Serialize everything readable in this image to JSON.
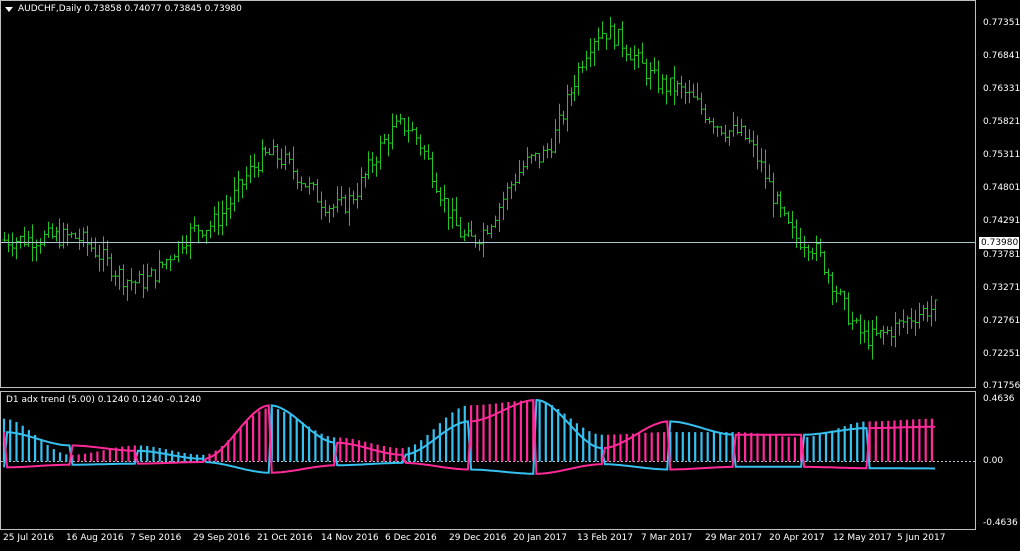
{
  "main": {
    "symbol_header": "AUDCHF,Daily",
    "ohlc": "0.73858 0.74077 0.73845 0.73980",
    "current_price": "0.73980",
    "y_ticks": [
      "0.77351",
      "0.76841",
      "0.76331",
      "0.75821",
      "0.75311",
      "0.74801",
      "0.74291",
      "0.73781",
      "0.73271",
      "0.72761",
      "0.72251",
      "0.71756"
    ]
  },
  "indicator": {
    "header": "D1 adx trend (5.00) 0.1240 0.1240 -0.1240",
    "y_ticks": [
      "0.4636",
      "0.00",
      "-0.4636"
    ]
  },
  "x_ticks": [
    "25 Jul 2016",
    "16 Aug 2016",
    "7 Sep 2016",
    "29 Sep 2016",
    "21 Oct 2016",
    "14 Nov 2016",
    "6 Dec 2016",
    "29 Dec 2016",
    "20 Jan 2017",
    "13 Feb 2017",
    "7 Mar 2017",
    "29 Mar 2017",
    "20 Apr 2017",
    "12 May 2017",
    "5 Jun 2017"
  ],
  "colors": {
    "bars": "#22c322",
    "cyan": "#36c0f0",
    "magenta": "#ff2a9a",
    "grid_line": "#aac8d0"
  },
  "chart_data": [
    {
      "type": "ohlc",
      "title": "AUDCHF,Daily",
      "ylim": [
        0.7171,
        0.776
      ],
      "x": [
        "25 Jul 2016",
        "16 Aug 2016",
        "7 Sep 2016",
        "29 Sep 2016",
        "21 Oct 2016",
        "14 Nov 2016",
        "6 Dec 2016",
        "29 Dec 2016",
        "20 Jan 2017",
        "13 Feb 2017",
        "7 Mar 2017",
        "29 Mar 2017",
        "20 Apr 2017",
        "12 May 2017",
        "5 Jun 2017"
      ],
      "close": [
        0.7395,
        0.74,
        0.733,
        0.7415,
        0.7525,
        0.7445,
        0.757,
        0.7395,
        0.752,
        0.7715,
        0.763,
        0.756,
        0.7395,
        0.7245,
        0.729
      ]
    },
    {
      "type": "area",
      "title": "D1 adx trend (5.00) 0.1240 0.1240 -0.1240",
      "ylim": [
        -0.4636,
        0.4636
      ],
      "x": [
        "25 Jul 2016",
        "16 Aug 2016",
        "7 Sep 2016",
        "29 Sep 2016",
        "21 Oct 2016",
        "14 Nov 2016",
        "6 Dec 2016",
        "29 Dec 2016",
        "20 Jan 2017",
        "13 Feb 2017",
        "7 Mar 2017",
        "29 Mar 2017",
        "20 Apr 2017",
        "12 May 2017",
        "5 Jun 2017"
      ],
      "series": [
        {
          "values": [
            0.32,
            0.05,
            0.12,
            0.05,
            0.4,
            0.18,
            0.1,
            0.42,
            0.46,
            0.2,
            0.22,
            0.22,
            0.18,
            0.3,
            0.32
          ]
        },
        {
          "values": [
            -0.22,
            -0.12,
            -0.08,
            -0.02,
            -0.42,
            -0.14,
            -0.05,
            -0.3,
            -0.46,
            -0.1,
            -0.3,
            -0.2,
            -0.2,
            -0.25,
            -0.26
          ]
        }
      ]
    }
  ]
}
